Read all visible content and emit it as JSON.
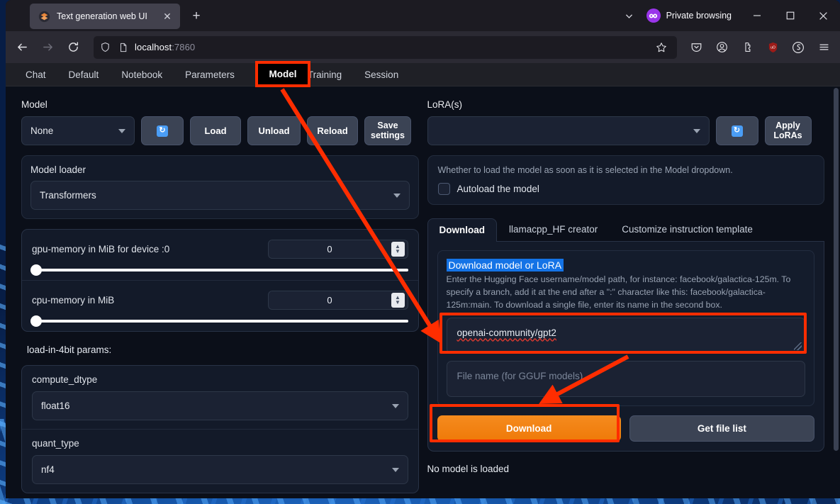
{
  "browser": {
    "tab": {
      "title": "Text generation web UI",
      "favicon": "app-favicon",
      "close": "✕"
    },
    "new_tab": "+",
    "private_browsing": "Private browsing",
    "window_controls": {
      "minimize": "—",
      "maximize": "□",
      "close": "✕"
    },
    "url": {
      "host": "localhost",
      "port": ":7860"
    },
    "toolbar_icons": [
      "pocket-icon",
      "account-icon",
      "extensions-icon",
      "ublock-icon",
      "shield-icon",
      "menu-icon"
    ]
  },
  "gradio_tabs": [
    {
      "label": "Chat",
      "active": false
    },
    {
      "label": "Default",
      "active": false
    },
    {
      "label": "Notebook",
      "active": false
    },
    {
      "label": "Parameters",
      "active": false
    },
    {
      "label": "Model",
      "active": true
    },
    {
      "label": "Training",
      "active": false
    },
    {
      "label": "Session",
      "active": false
    }
  ],
  "left": {
    "section_label": "Model",
    "model_dropdown_value": "None",
    "refresh_icon": "refresh-icon",
    "buttons": [
      "Load",
      "Unload",
      "Reload",
      "Save settings"
    ],
    "model_loader": {
      "label": "Model loader",
      "value": "Transformers"
    },
    "sliders": [
      {
        "label": "gpu-memory in MiB for device :0",
        "value": "0"
      },
      {
        "label": "cpu-memory in MiB",
        "value": "0"
      }
    ],
    "params_label": "load-in-4bit params:",
    "params": [
      {
        "label": "compute_dtype",
        "value": "float16"
      },
      {
        "label": "quant_type",
        "value": "nf4"
      }
    ]
  },
  "right": {
    "section_label": "LoRA(s)",
    "lora_dropdown_value": "",
    "refresh_icon": "refresh-icon",
    "apply_button": "Apply LoRAs",
    "autoload": {
      "description": "Whether to load the model as soon as it is selected in the Model dropdown.",
      "label": "Autoload the model",
      "checked": false
    },
    "subtabs": [
      {
        "label": "Download",
        "active": true
      },
      {
        "label": "llamacpp_HF creator",
        "active": false
      },
      {
        "label": "Customize instruction template",
        "active": false
      }
    ],
    "download": {
      "title": "Download model or LoRA",
      "description": "Enter the Hugging Face username/model path, for instance: facebook/galactica-125m. To specify a branch, add it at the end after a \":\" character like this: facebook/galactica-125m:main. To download a single file, enter its name in the second box.",
      "model_path_value": "openai-community/gpt2",
      "file_name_placeholder": "File name (for GGUF models)",
      "file_name_value": "",
      "download_button": "Download",
      "get_file_list_button": "Get file list"
    },
    "status": "No model is loaded"
  },
  "annotation": {
    "highlight_color": "#ff2d00",
    "boxes": [
      "model-tab",
      "model-path-input",
      "download-button"
    ],
    "arrows": [
      "model-tab-to-model-path",
      "file-name-to-download-button"
    ]
  }
}
